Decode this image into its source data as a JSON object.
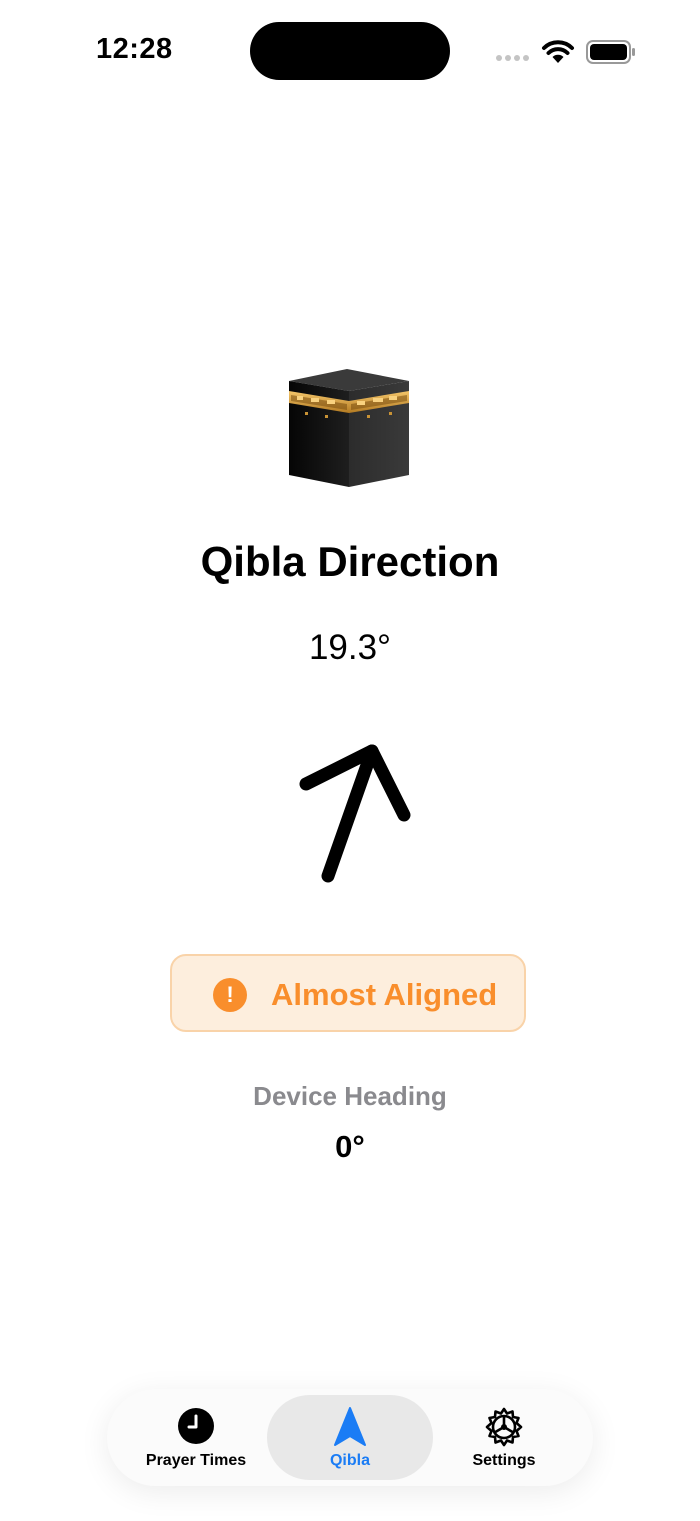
{
  "status_bar": {
    "time": "12:28"
  },
  "qibla": {
    "title": "Qibla Direction",
    "angle": "19.3°",
    "alignment_status": "Almost Aligned",
    "device_heading_label": "Device Heading",
    "device_heading_value": "0°",
    "arrow_rotation_deg": 19.3
  },
  "tabs": [
    {
      "label": "Prayer Times",
      "icon": "clock-icon",
      "active": false
    },
    {
      "label": "Qibla",
      "icon": "navigation-arrow-icon",
      "active": true
    },
    {
      "label": "Settings",
      "icon": "gear-icon",
      "active": false
    }
  ],
  "colors": {
    "accent": "#1a7cf5",
    "warning": "#f98e2c",
    "warning_bg": "#fdeedd",
    "secondary_text": "#8a8a8e"
  }
}
